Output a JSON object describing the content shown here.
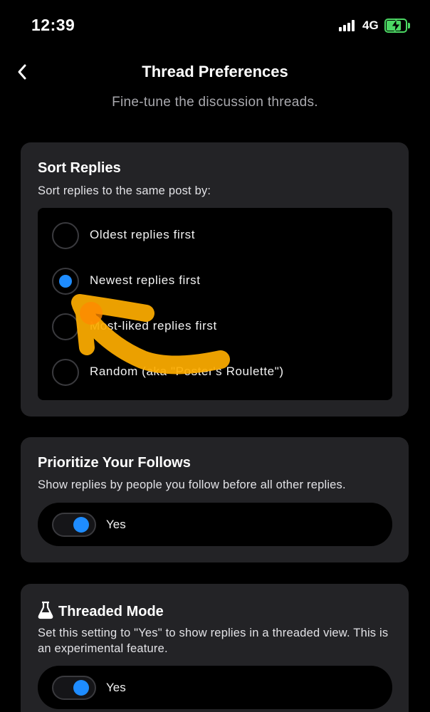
{
  "status_bar": {
    "time": "12:39",
    "network": "4G",
    "battery_level": 0.75,
    "battery_color": "#4cd964"
  },
  "header": {
    "back_icon": "chevron-left-icon",
    "title": "Thread Preferences",
    "subtitle": "Fine-tune the discussion threads."
  },
  "sort_replies": {
    "title": "Sort Replies",
    "description": "Sort replies to the same post by:",
    "options": [
      {
        "label": "Oldest replies first",
        "selected": false
      },
      {
        "label": "Newest replies first",
        "selected": true
      },
      {
        "label": "Most-liked replies first",
        "selected": false
      },
      {
        "label": "Random (aka \"Poster's Roulette\")",
        "selected": false
      }
    ]
  },
  "prioritize_follows": {
    "title": "Prioritize Your Follows",
    "description": "Show replies by people you follow before all other replies.",
    "toggle_label": "Yes",
    "enabled": true
  },
  "threaded_mode": {
    "icon": "flask-icon",
    "title": "Threaded Mode",
    "description": "Set this setting to \"Yes\" to show replies in a threaded view. This is an experimental feature.",
    "toggle_label": "Yes",
    "enabled": true
  },
  "colors": {
    "background": "#000000",
    "card": "#232326",
    "accent": "#1e8cff",
    "annotation": "#ffae00"
  }
}
